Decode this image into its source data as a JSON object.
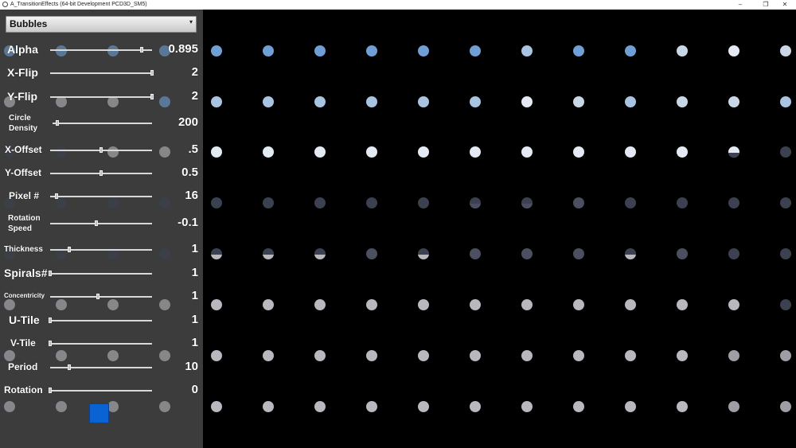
{
  "window": {
    "title": "A_TransitionEffects (64-bit Development PCD3D_SM5)",
    "controls": {
      "minimize": "–",
      "restore": "❐",
      "close": "✕"
    }
  },
  "effect_dropdown": {
    "selected": "Bubbles",
    "arrow": "▾"
  },
  "sliders": [
    {
      "label": "Alpha",
      "value": "0.895",
      "position": 0.9
    },
    {
      "label": "X-Flip",
      "value": "2",
      "position": 1.0
    },
    {
      "label": "Y-Flip",
      "value": "2",
      "position": 1.0
    },
    {
      "label": "Circle\nDensity",
      "value": "200",
      "position": 0.05
    },
    {
      "label": "X-Offset",
      "value": ".5",
      "position": 0.5
    },
    {
      "label": "Y-Offset",
      "value": "0.5",
      "position": 0.5
    },
    {
      "label": "Pixel #",
      "value": "16",
      "position": 0.06
    },
    {
      "label": "Rotation\nSpeed",
      "value": "-0.1",
      "position": 0.45
    },
    {
      "label": "Thickness",
      "value": "1",
      "position": 0.19
    },
    {
      "label": "Spirals#",
      "value": "1",
      "position": 0.0
    },
    {
      "label": "Concentricity",
      "value": "1",
      "position": 0.47
    },
    {
      "label": "U-Tile",
      "value": "1",
      "position": 0.0
    },
    {
      "label": "V-Tile",
      "value": "1",
      "position": 0.0
    },
    {
      "label": "Period",
      "value": "10",
      "position": 0.19
    },
    {
      "label": "Rotation",
      "value": "0",
      "position": 0.0
    }
  ],
  "color_swatch": {
    "color": "#0a63d3"
  },
  "dot_grid": {
    "palette": {
      "B": "#6f9fd4",
      "b": "#a9c3e3",
      "W": "#e4eaf3",
      "w": "#c9d6e6",
      "D": "#3b4150",
      "d": "#4a5060",
      "G": "#b8b9bf",
      "g": "#9d9ea6"
    },
    "rows": [
      [
        "B",
        "B",
        "B",
        "B",
        "B",
        "B",
        "b",
        "B",
        "B",
        "w",
        "W",
        "w"
      ],
      [
        "b",
        "b",
        "b",
        "b",
        "b",
        "b",
        "W",
        "w",
        "b",
        "w",
        "w",
        "b"
      ],
      [
        "W",
        "W",
        "W",
        "W",
        "W",
        "W",
        "W",
        "W",
        "W",
        "W",
        "W-D",
        "D"
      ],
      [
        "D",
        "D",
        "D",
        "D",
        "D",
        "D-d",
        "D-d",
        "d",
        "D",
        "D",
        "D",
        "D"
      ],
      [
        "D-G",
        "D-G",
        "D-G",
        "d",
        "D-G",
        "d",
        "d",
        "d",
        "D-G",
        "d",
        "D",
        "D"
      ],
      [
        "G",
        "G",
        "G",
        "G",
        "G",
        "G",
        "G",
        "G",
        "G",
        "G",
        "G",
        "D"
      ],
      [
        "G",
        "G",
        "G",
        "G",
        "G",
        "G",
        "G",
        "G",
        "G",
        "G",
        "g",
        "g"
      ],
      [
        "G",
        "G",
        "G",
        "G",
        "G",
        "G",
        "G",
        "G",
        "G",
        "G",
        "g",
        "g"
      ]
    ],
    "panel_row_dots": [
      [
        "B",
        "B",
        "B",
        "B"
      ],
      [
        "G",
        "G",
        "G",
        "B"
      ],
      [
        "D",
        "D",
        "G",
        "G"
      ],
      [
        "D",
        "D",
        "D",
        "D"
      ],
      [
        "D",
        "D",
        "D",
        "D"
      ],
      [
        "G",
        "G",
        "G",
        "G"
      ],
      [
        "G",
        "G",
        "G",
        "G"
      ],
      [
        "G",
        "G",
        "G",
        "G"
      ]
    ]
  }
}
